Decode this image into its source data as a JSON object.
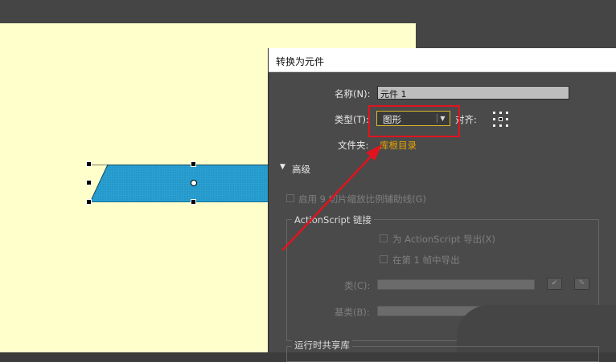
{
  "dialog": {
    "title": "转换为元件",
    "name_label": "名称(N):",
    "name_value": "元件 1",
    "type_label": "类型(T):",
    "type_value": "图形",
    "align_label": "对齐:",
    "folder_label": "文件夹:",
    "folder_link": "库根目录",
    "advanced_label": "高级",
    "scale9_label": "启用 9 切片缩放比例辅助线(G)",
    "actionscript_group": "ActionScript 链接",
    "export_as_label": "为 ActionScript 导出(X)",
    "export_frame1_label": "在第 1 帧中导出",
    "class_label": "类(C):",
    "base_class_label": "基类(B):",
    "runtime_shared_label": "运行时共享库"
  },
  "colors": {
    "annotation_red": "#e0141e",
    "shape_fill": "#2aa0d2",
    "stage_bg": "#ffffcc"
  },
  "icons": {
    "disclosure": "triangle-down",
    "dropdown": "chevron-down",
    "validate": "check",
    "edit": "pencil",
    "registration": "grid-3x3"
  }
}
